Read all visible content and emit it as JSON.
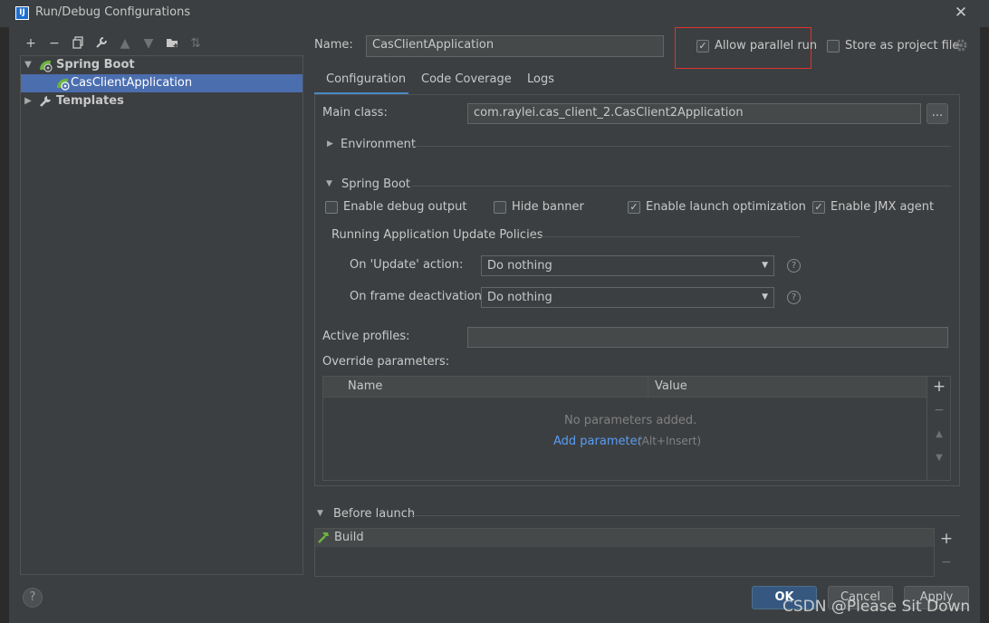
{
  "window": {
    "title": "Run/Debug Configurations",
    "app_icon": "IJ"
  },
  "toolbar": {
    "icons": [
      "add-icon",
      "remove-icon",
      "copy-icon",
      "wrench-icon",
      "move-up-icon",
      "move-down-icon",
      "folder-icon",
      "sort-icon"
    ]
  },
  "tree": {
    "items": [
      {
        "label": "Spring Boot",
        "level": 0,
        "expanded": true
      },
      {
        "label": "CasClientApplication",
        "level": 1,
        "selected": true
      },
      {
        "label": "Templates",
        "level": 0,
        "expanded": false
      }
    ]
  },
  "header": {
    "name_label": "Name:",
    "name_value": "CasClientApplication",
    "allow_parallel": {
      "label": "Allow parallel run",
      "checked": true
    },
    "store_project": {
      "label": "Store as project file",
      "checked": false
    }
  },
  "tabs": [
    "Configuration",
    "Code Coverage",
    "Logs"
  ],
  "config": {
    "main_class_label": "Main class:",
    "main_class_value": "com.raylei.cas_client_2.CasClient2Application",
    "browse_label": "...",
    "environment_label": "Environment",
    "spring_boot_label": "Spring Boot",
    "checkboxes": [
      {
        "label": "Enable debug output",
        "checked": false
      },
      {
        "label": "Hide banner",
        "checked": false
      },
      {
        "label": "Enable launch optimization",
        "checked": true
      },
      {
        "label": "Enable JMX agent",
        "checked": true
      }
    ],
    "policies_title": "Running Application Update Policies",
    "update_action_label": "On 'Update' action:",
    "update_action_value": "Do nothing",
    "frame_deactivation_label": "On frame deactivation:",
    "frame_deactivation_value": "Do nothing",
    "help_glyph": "?",
    "active_profiles_label": "Active profiles:",
    "active_profiles_value": "",
    "override_label": "Override parameters:",
    "table": {
      "columns": [
        "Name",
        "Value"
      ],
      "empty_text": "No parameters added.",
      "add_link": "Add parameter",
      "add_hint": "(Alt+Insert)"
    }
  },
  "before_launch": {
    "label": "Before launch",
    "items": [
      "Build"
    ]
  },
  "footer": {
    "help": "?",
    "ok": "OK",
    "cancel": "Cancel",
    "apply": "Apply",
    "watermark": "CSDN @Please Sit Down"
  },
  "colors": {
    "accent": "#4a88c7",
    "selection": "#4b6eaf",
    "link": "#589df6",
    "highlight_box": "#e03131",
    "spring_green": "#6db33f"
  }
}
